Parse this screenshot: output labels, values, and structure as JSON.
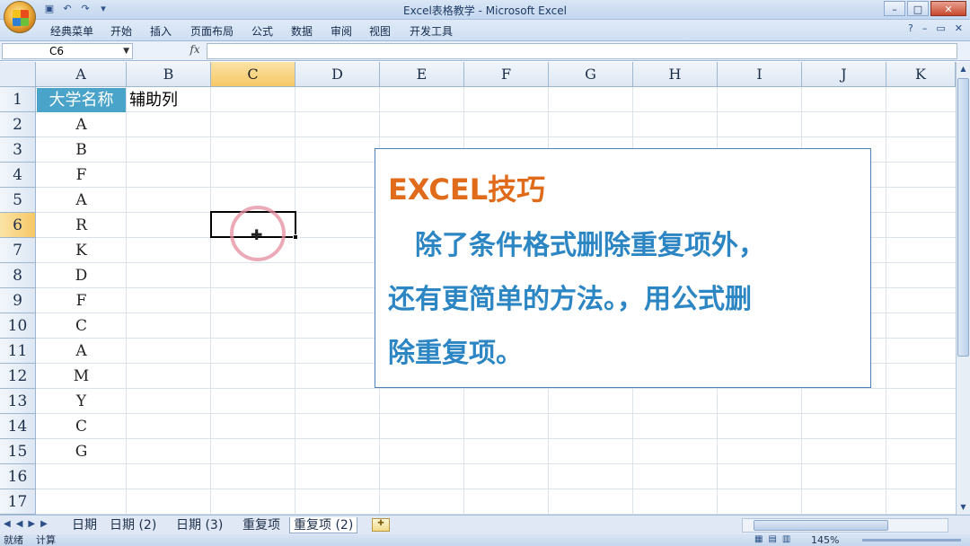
{
  "window": {
    "title": "Excel表格教学 - Microsoft Excel",
    "controls": [
      "–",
      "□",
      "✕"
    ]
  },
  "quick_access": [
    "save-icon",
    "undo-icon",
    "redo-icon",
    "customize-icon"
  ],
  "menu": {
    "tabs": [
      "经典菜单",
      "开始",
      "插入",
      "页面布局",
      "公式",
      "数据",
      "审阅",
      "视图",
      "开发工具"
    ],
    "help": "?"
  },
  "formula_bar": {
    "name_box": "C6",
    "fx": "fx",
    "value": ""
  },
  "columns": [
    "A",
    "B",
    "C",
    "D",
    "E",
    "F",
    "G",
    "H",
    "I",
    "J",
    "K"
  ],
  "active_column": "C",
  "rows": [
    "1",
    "2",
    "3",
    "4",
    "5",
    "6",
    "7",
    "8",
    "9",
    "10",
    "11",
    "12",
    "13",
    "14",
    "15",
    "16",
    "17"
  ],
  "active_row": "6",
  "cells": {
    "a1": "大学名称",
    "b1": "辅助列",
    "column_a": [
      "A",
      "B",
      "F",
      "A",
      "R",
      "K",
      "D",
      "F",
      "C",
      "A",
      "M",
      "Y",
      "C",
      "G"
    ]
  },
  "textbox": {
    "title": "EXCEL技巧",
    "lines": [
      "　除了条件格式删除重复项外，",
      "还有更简单的方法。，用公式删",
      "除重复项。"
    ],
    "title_color": "#e06b1a",
    "body_color": "#2d86c4"
  },
  "sheet_tabs": [
    "日期",
    "日期 (2)",
    "日期 (3)",
    "重复项",
    "重复项 (2)"
  ],
  "active_sheet": "重复项 (2)",
  "status": {
    "ready": "就绪",
    "calc": "计算",
    "zoom": "145%"
  }
}
